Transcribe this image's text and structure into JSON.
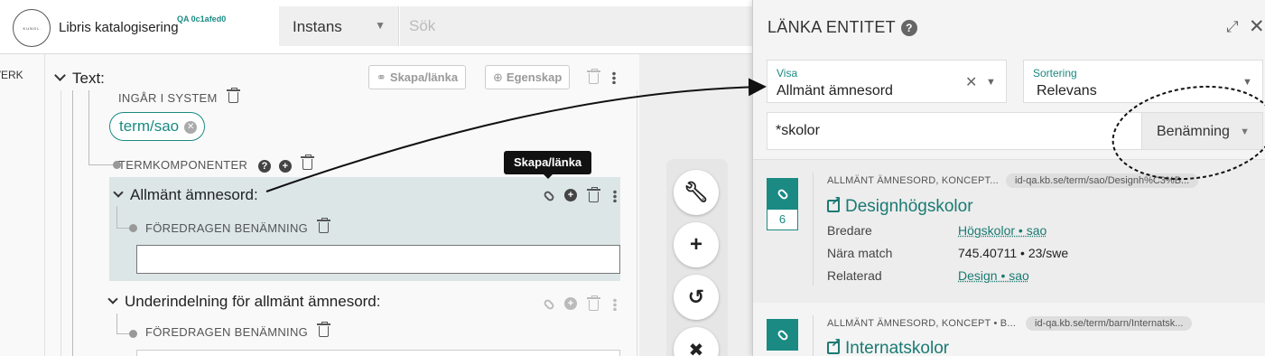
{
  "topbar": {
    "logo_text": "KUNGL. BIBLIOTEKET",
    "app_name": "Libris katalogisering",
    "env_tag": "QA 0c1afed0",
    "search_type": "Instans",
    "search_placeholder": "Sök"
  },
  "editor": {
    "left_stub_label": "VERK",
    "title": "Text:",
    "create_link_btn": "Skapa/länka",
    "property_btn": "Egenskap",
    "ingar_label": "INGÅR I SYSTEM",
    "term_pill": "term/sao",
    "termkomponenter_label": "TERMKOMPONENTER",
    "term_block_title": "Allmänt ämnesord:",
    "preferred_label_1": "FÖREDRAGEN BENÄMNING",
    "term_input_value": "",
    "under_title": "Underindelning för allmänt ämnesord:",
    "preferred_label_2": "FÖREDRAGEN BENÄMNING",
    "tooltip": "Skapa/länka"
  },
  "toolstrip": {
    "icons": [
      "wrench-icon",
      "plus-icon",
      "undo-icon",
      "close-icon"
    ]
  },
  "panel": {
    "title": "LÄNKA ENTITET",
    "visa_label": "Visa",
    "visa_value": "Allmänt ämnesord",
    "sort_label": "Sortering",
    "sort_value": "Relevans",
    "query_value": "*skolor",
    "query_type": "Benämning",
    "results": [
      {
        "type": "ALLMÄNT ÄMNESORD, KONCEPT...",
        "uri": "id-qa.kb.se/term/sao/Designh%C3%B...",
        "title": "Designhögskolor",
        "count": "6",
        "rows": [
          {
            "key": "Bredare",
            "value": "Högskolor • sao",
            "link": true
          },
          {
            "key": "Nära match",
            "value": "745.40711 • 23/swe",
            "link": false
          },
          {
            "key": "Relaterad",
            "value": "Design • sao",
            "link": true
          }
        ]
      },
      {
        "type": "ALLMÄNT ÄMNESORD, KONCEPT • B...",
        "uri": "id-qa.kb.se/term/barn/Internatsk...",
        "title": "Internatskolor",
        "count": "",
        "rows": []
      }
    ]
  },
  "colors": {
    "accent": "#1a8a83",
    "link": "#1a7a73",
    "term_block_bg": "#dce6e7",
    "tooltip_bg": "#111111"
  }
}
